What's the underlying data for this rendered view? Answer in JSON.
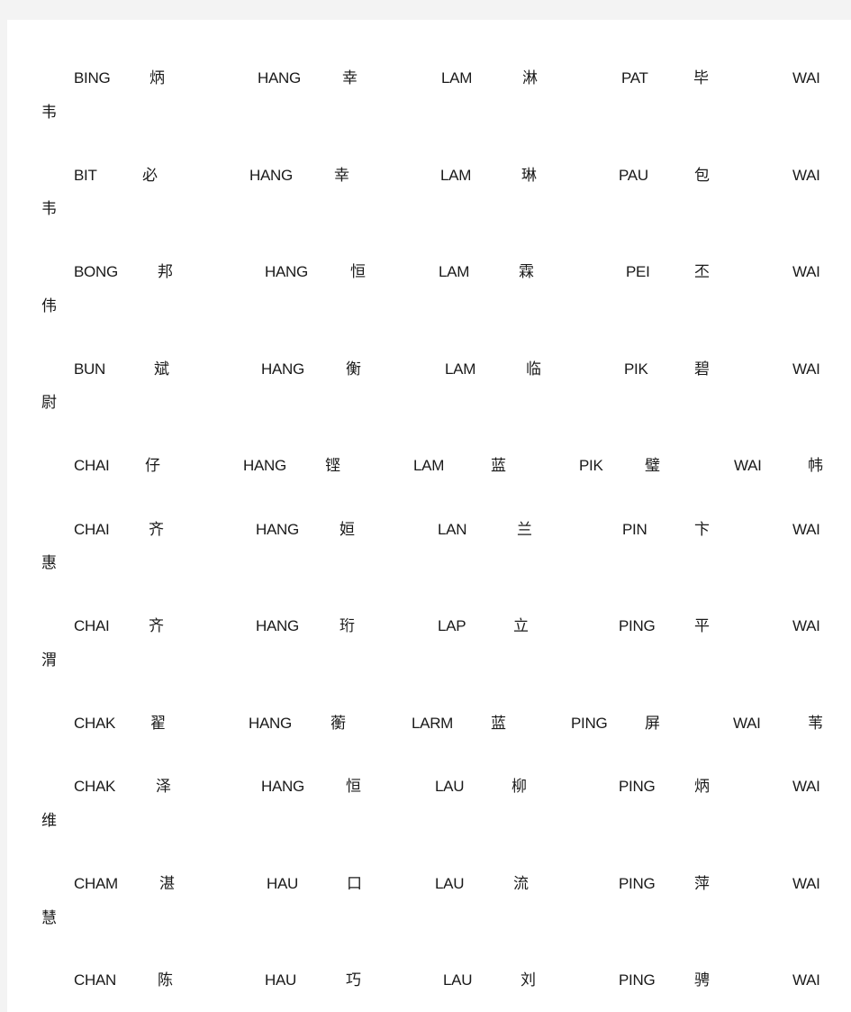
{
  "rows": [
    {
      "cells": [
        "BING",
        "炳",
        "HANG",
        "幸",
        "LAM",
        "淋",
        "PAT",
        "毕",
        "WAI"
      ],
      "wrap": "韦"
    },
    {
      "cells": [
        "BIT",
        "必",
        "HANG",
        "幸",
        "LAM",
        "琳",
        "PAU",
        "包",
        "WAI"
      ],
      "wrap": "韦"
    },
    {
      "cells": [
        "BONG",
        "邦",
        "HANG",
        "恒",
        "LAM",
        "霖",
        "PEI",
        "丕",
        "WAI"
      ],
      "wrap": "伟"
    },
    {
      "cells": [
        "BUN",
        "斌",
        "HANG",
        "衡",
        "LAM",
        "临",
        "PIK",
        "碧",
        "WAI"
      ],
      "wrap": "尉"
    },
    {
      "cells": [
        "CHAI",
        "仔",
        "HANG",
        "铿",
        "LAM",
        "蓝",
        "PIK",
        "璧",
        "WAI",
        "帏"
      ],
      "wrap": null
    },
    {
      "cells": [
        "CHAI",
        "齐",
        "HANG",
        "姮",
        "LAN",
        "兰",
        "PIN",
        "卞",
        "WAI"
      ],
      "wrap": "惠"
    },
    {
      "cells": [
        "CHAI",
        "齐",
        "HANG",
        "珩",
        "LAP",
        "立",
        "PING",
        "平",
        "WAI"
      ],
      "wrap": "渭"
    },
    {
      "cells": [
        "CHAK",
        "翟",
        "HANG",
        "蘅",
        "LARM",
        "蓝",
        "PING",
        "屏",
        "WAI",
        "苇"
      ],
      "wrap": null
    },
    {
      "cells": [
        "CHAK",
        "泽",
        "HANG",
        "恒",
        "LAU",
        "柳",
        "PING",
        "炳",
        "WAI"
      ],
      "wrap": "维"
    },
    {
      "cells": [
        "CHAM",
        "湛",
        "HAU",
        "口",
        "LAU",
        "流",
        "PING",
        "萍",
        "WAI"
      ],
      "wrap": "慧"
    },
    {
      "cells": [
        "CHAN",
        "陈",
        "HAU",
        "巧",
        "LAU",
        "刘",
        "PING",
        "骋",
        "WAI"
      ],
      "wrap": null
    }
  ]
}
